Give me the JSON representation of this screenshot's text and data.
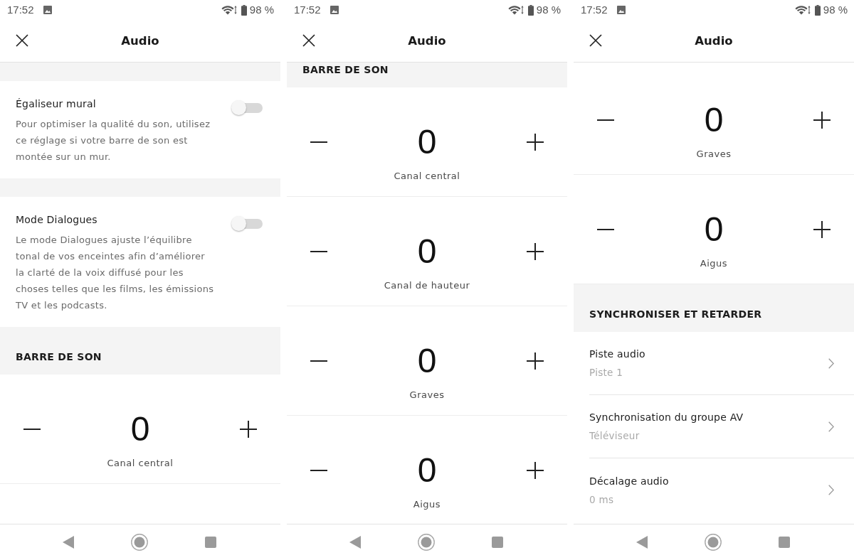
{
  "screens": [
    {
      "status_bar": {
        "time": "17:52",
        "battery": "98 %"
      },
      "app_bar": {
        "title": "Audio"
      },
      "content": [
        {
          "kind": "gap"
        },
        {
          "kind": "toggle",
          "title": "Égaliseur mural",
          "description": "Pour optimiser la qualité du son, utilisez ce réglage si votre barre de son est montée sur un mur.",
          "on": false
        },
        {
          "kind": "gap"
        },
        {
          "kind": "toggle",
          "title": "Mode Dialogues",
          "description": "Le mode Dialogues ajuste l’équilibre tonal de vos enceintes afin d’améliorer la clarté de la voix diffusé pour les choses telles que les films, les émissions TV et les podcasts.",
          "on": false
        },
        {
          "kind": "header",
          "label": "BARRE DE SON"
        },
        {
          "kind": "stepper",
          "value": "0",
          "label": "Canal central"
        }
      ]
    },
    {
      "status_bar": {
        "time": "17:52",
        "battery": "98 %"
      },
      "app_bar": {
        "title": "Audio"
      },
      "content": [
        {
          "kind": "header",
          "label": "BARRE DE SON"
        },
        {
          "kind": "stepper",
          "value": "0",
          "label": "Canal central"
        },
        {
          "kind": "stepper",
          "value": "0",
          "label": "Canal de hauteur"
        },
        {
          "kind": "stepper",
          "value": "0",
          "label": "Graves"
        },
        {
          "kind": "stepper",
          "value": "0",
          "label": "Aigus"
        }
      ]
    },
    {
      "status_bar": {
        "time": "17:52",
        "battery": "98 %"
      },
      "app_bar": {
        "title": "Audio"
      },
      "content": [
        {
          "kind": "stepper",
          "value": "0",
          "label": "Graves"
        },
        {
          "kind": "stepper",
          "value": "0",
          "label": "Aigus"
        },
        {
          "kind": "header",
          "label": "SYNCHRONISER ET RETARDER"
        },
        {
          "kind": "link",
          "title": "Piste audio",
          "value": "Piste 1"
        },
        {
          "kind": "link",
          "title": "Synchronisation du groupe AV",
          "value": "Téléviseur"
        },
        {
          "kind": "link",
          "title": "Décalage audio",
          "value": "0 ms"
        }
      ]
    }
  ]
}
